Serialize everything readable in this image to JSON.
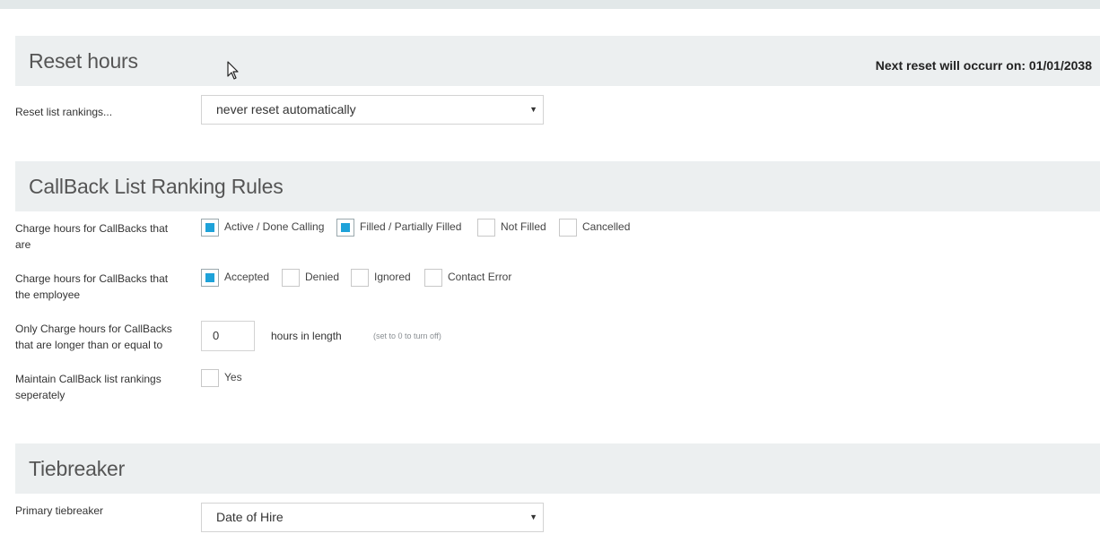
{
  "reset_section": {
    "title": "Reset hours",
    "next_reset": "Next reset will occurr on: 01/01/2038",
    "reset_label": "Reset list rankings...",
    "reset_value": "never reset automatically"
  },
  "rules_section": {
    "title": "CallBack List Ranking Rules",
    "charge_are_label": "Charge hours for CallBacks that are",
    "charge_are_options": [
      {
        "label": "Active / Done Calling",
        "checked": true
      },
      {
        "label": "Filled / Partially Filled",
        "checked": true
      },
      {
        "label": "Not Filled",
        "checked": false
      },
      {
        "label": "Cancelled",
        "checked": false
      }
    ],
    "charge_employee_label": "Charge hours for CallBacks that the employee",
    "charge_employee_options": [
      {
        "label": "Accepted",
        "checked": true
      },
      {
        "label": "Denied",
        "checked": false
      },
      {
        "label": "Ignored",
        "checked": false
      },
      {
        "label": "Contact Error",
        "checked": false
      }
    ],
    "length_label": "Only Charge hours for CallBacks that are longer than or equal to",
    "length_value": "0",
    "length_unit": "hours in length",
    "length_hint": "(set to 0 to turn off)",
    "separate_label": "Maintain CallBack list rankings seperately",
    "separate_option": {
      "label": "Yes",
      "checked": false
    }
  },
  "tiebreaker_section": {
    "title": "Tiebreaker",
    "primary_label": "Primary tiebreaker",
    "primary_value": "Date of Hire"
  },
  "icons": {
    "dropdown": "chevron-down-icon",
    "cursor": "mouse-pointer-icon"
  },
  "colors": {
    "accent": "#1ea2d9",
    "header_bg": "#eceff0"
  }
}
